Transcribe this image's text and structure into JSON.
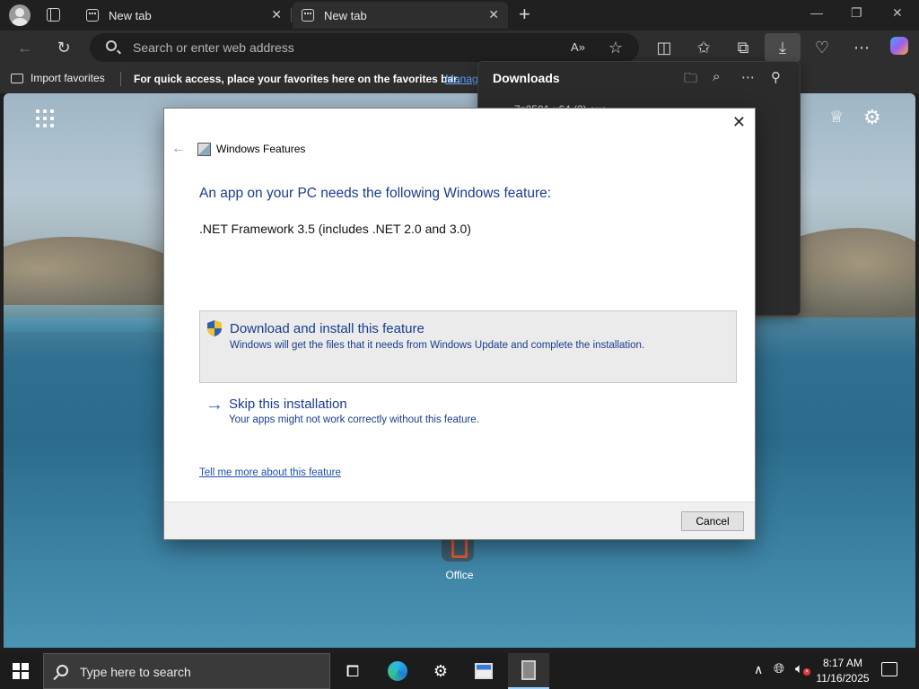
{
  "browser": {
    "tabs": [
      {
        "label": "New tab"
      },
      {
        "label": "New tab"
      }
    ],
    "new_tab_symbol": "+",
    "window_controls": {
      "minimize": "—",
      "restore": "❐",
      "close": "✕"
    },
    "address_bar": {
      "placeholder": "Search or enter web address"
    },
    "toolbar_icons": [
      "back-icon",
      "refresh-icon",
      "read-aloud-icon",
      "favorite-icon",
      "split-screen-icon",
      "favorites-icon",
      "collections-icon",
      "downloads-icon",
      "browser-essentials-icon",
      "more-icon",
      "copilot-icon"
    ],
    "favorites_bar": {
      "import_label": "Import favorites",
      "hint": "For quick access, place your favorites here on the favorites bar.",
      "manage_link": "Manage favorites now"
    }
  },
  "downloads_panel": {
    "title": "Downloads",
    "partial_file": "7z2501-x64 (2).exe"
  },
  "new_tab_page": {
    "shortcut_label": "Office"
  },
  "dialog": {
    "title": "Windows Features",
    "heading": "An app on your PC needs the following Windows feature:",
    "feature": ".NET Framework 3.5 (includes .NET 2.0 and 3.0)",
    "options": [
      {
        "title": "Download and install this feature",
        "description": "Windows will get the files that it needs from Windows Update and complete the installation."
      },
      {
        "title": "Skip this installation",
        "description": "Your apps might not work correctly without this feature."
      }
    ],
    "link": "Tell me more about this feature",
    "cancel_label": "Cancel"
  },
  "taskbar": {
    "search_text": "Type here to search",
    "time": "8:17 AM",
    "date": "11/16/2025"
  },
  "colors": {
    "dialog_link_blue": "#183c8c",
    "chrome_dark": "#202020",
    "toolbar_dark": "#2e2e2e"
  }
}
